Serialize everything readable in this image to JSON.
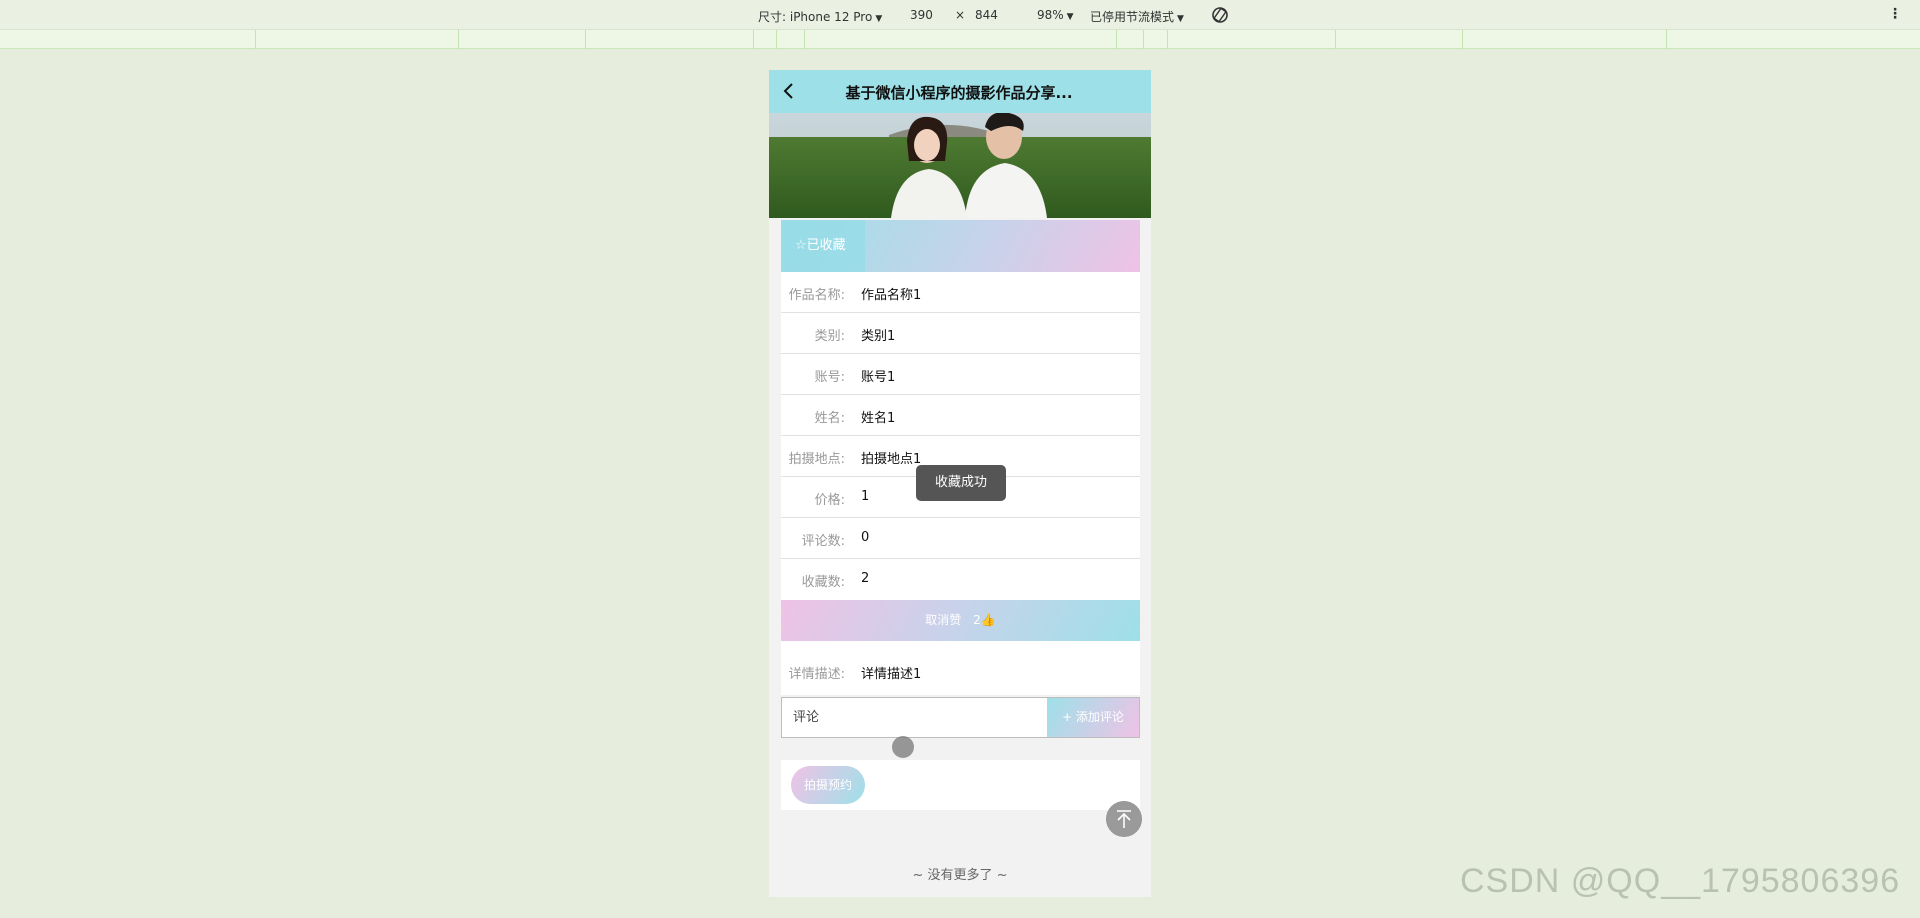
{
  "devtools": {
    "device_label": "尺寸: iPhone 12 Pro",
    "width": "390",
    "times": "×",
    "height": "844",
    "zoom": "98%",
    "throttle": "已停用节流模式"
  },
  "navbar": {
    "title": "基于微信小程序的摄影作品分享..."
  },
  "favorite": {
    "label": "☆已收藏"
  },
  "details": [
    {
      "label": "作品名称:",
      "value": "作品名称1"
    },
    {
      "label": "类别:",
      "value": "类别1"
    },
    {
      "label": "账号:",
      "value": "账号1"
    },
    {
      "label": "姓名:",
      "value": "姓名1"
    },
    {
      "label": "拍摄地点:",
      "value": "拍摄地点1"
    },
    {
      "label": "价格:",
      "value": "1"
    },
    {
      "label": "评论数:",
      "value": "0"
    },
    {
      "label": "收藏数:",
      "value": "2"
    }
  ],
  "like": {
    "label": "取消赞",
    "count": "2👍"
  },
  "description": {
    "label": "详情描述:",
    "value": "详情描述1"
  },
  "comment": {
    "placeholder": "评论",
    "add_label": "+ 添加评论"
  },
  "booking": {
    "label": "拍摄预约"
  },
  "footer": {
    "no_more": "~ 没有更多了 ~"
  },
  "toast": {
    "message": "收藏成功"
  },
  "watermark": "CSDN @QQ__1795806396",
  "colors": {
    "navbar": "#9ee0e8",
    "accent_pink": "#efc2e6",
    "page_bg": "#e6eddc"
  }
}
